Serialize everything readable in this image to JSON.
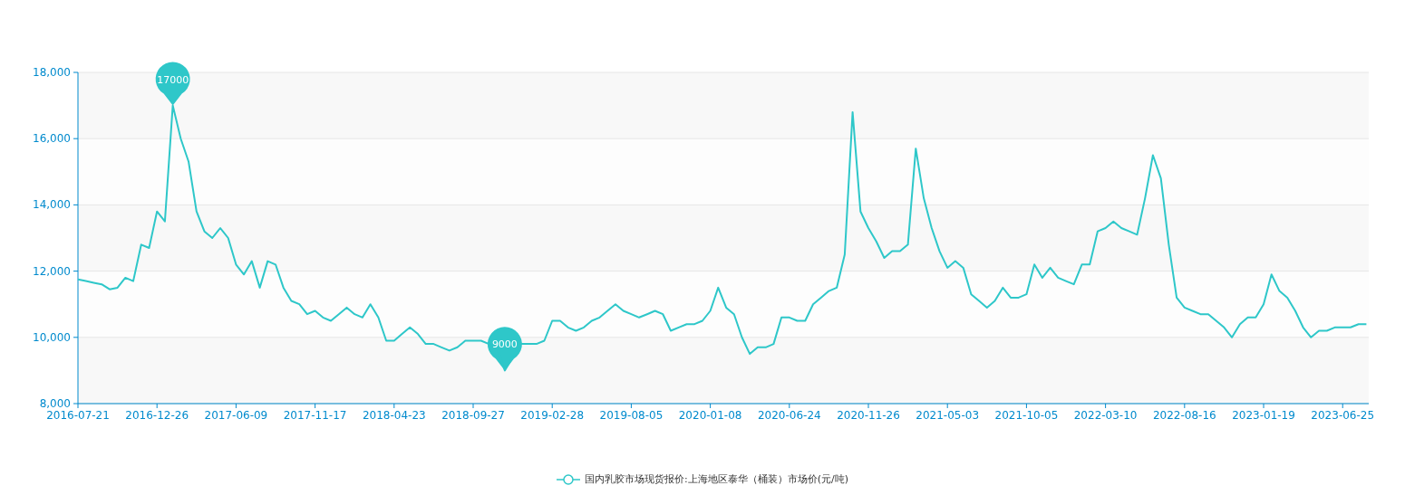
{
  "chart_data": {
    "type": "line",
    "categories": [
      "2016-07-21",
      null,
      null,
      null,
      null,
      null,
      null,
      null,
      null,
      null,
      "2016-12-26",
      null,
      null,
      null,
      null,
      null,
      null,
      null,
      null,
      null,
      "2017-06-09",
      null,
      null,
      null,
      null,
      null,
      null,
      null,
      null,
      null,
      "2017-11-17",
      null,
      null,
      null,
      null,
      null,
      null,
      null,
      null,
      null,
      "2018-04-23",
      null,
      null,
      null,
      null,
      null,
      null,
      null,
      null,
      null,
      "2018-09-27",
      null,
      null,
      null,
      null,
      null,
      null,
      null,
      null,
      null,
      "2019-02-28",
      null,
      null,
      null,
      null,
      null,
      null,
      null,
      null,
      null,
      "2019-08-05",
      null,
      null,
      null,
      null,
      null,
      null,
      null,
      null,
      null,
      "2020-01-08",
      null,
      null,
      null,
      null,
      null,
      null,
      null,
      null,
      null,
      "2020-06-24",
      null,
      null,
      null,
      null,
      null,
      null,
      null,
      null,
      null,
      "2020-11-26",
      null,
      null,
      null,
      null,
      null,
      null,
      null,
      null,
      null,
      "2021-05-03",
      null,
      null,
      null,
      null,
      null,
      null,
      null,
      null,
      null,
      "2021-10-05",
      null,
      null,
      null,
      null,
      null,
      null,
      null,
      null,
      null,
      "2022-03-10",
      null,
      null,
      null,
      null,
      null,
      null,
      null,
      null,
      null,
      "2022-08-16",
      null,
      null,
      null,
      null,
      null,
      null,
      null,
      null,
      null,
      "2023-01-19",
      null,
      null,
      null,
      null,
      null,
      null,
      null,
      null,
      null,
      "2023-06-25",
      null,
      null,
      null
    ],
    "grid": true,
    "ylim": [
      8000,
      18000
    ],
    "yticks": [
      {
        "value": 8000,
        "label": "8,000"
      },
      {
        "value": 10000,
        "label": "10,000"
      },
      {
        "value": 12000,
        "label": "12,000"
      },
      {
        "value": 14000,
        "label": "14,000"
      },
      {
        "value": 16000,
        "label": "16,000"
      },
      {
        "value": 18000,
        "label": "18,000"
      }
    ],
    "series": [
      {
        "name": "国内乳胶市场现货报价:上海地区泰华（桶装）市场价(元/吨)",
        "color": "#2ec7c9",
        "values": [
          11750,
          11700,
          11650,
          11600,
          11450,
          11500,
          11800,
          11700,
          12800,
          12700,
          13800,
          13500,
          17000,
          16000,
          15300,
          13800,
          13200,
          13000,
          13300,
          13000,
          12200,
          11900,
          12300,
          11500,
          12300,
          12200,
          11500,
          11100,
          11000,
          10700,
          10800,
          10600,
          10500,
          10700,
          10900,
          10700,
          10600,
          11000,
          10600,
          9900,
          9900,
          10100,
          10300,
          10100,
          9800,
          9800,
          9700,
          9600,
          9700,
          9900,
          9900,
          9900,
          9800,
          9700,
          9000,
          9400,
          9800,
          9800,
          9800,
          9900,
          10500,
          10500,
          10300,
          10200,
          10300,
          10500,
          10600,
          10800,
          11000,
          10800,
          10700,
          10600,
          10700,
          10800,
          10700,
          10200,
          10300,
          10400,
          10400,
          10500,
          10800,
          11500,
          10900,
          10700,
          10000,
          9500,
          9700,
          9700,
          9800,
          10600,
          10600,
          10500,
          10500,
          11000,
          11200,
          11400,
          11500,
          12500,
          16800,
          13800,
          13300,
          12900,
          12400,
          12600,
          12600,
          12800,
          15700,
          14200,
          13300,
          12600,
          12100,
          12300,
          12100,
          11300,
          11100,
          10900,
          11100,
          11500,
          11200,
          11200,
          11300,
          12200,
          11800,
          12100,
          11800,
          11700,
          11600,
          12200,
          12200,
          13200,
          13300,
          13500,
          13300,
          13200,
          13100,
          14200,
          15500,
          14800,
          12800,
          11200,
          10900,
          10800,
          10700,
          10700,
          10500,
          10300,
          10000,
          10400,
          10600,
          10600,
          11000,
          11900,
          11400,
          11200,
          10800,
          10300,
          10000,
          10200,
          10200,
          10300,
          10300,
          10300,
          10400,
          10400
        ]
      }
    ],
    "annotations": [
      {
        "text": "17000"
      },
      {
        "text": "9000"
      }
    ]
  }
}
